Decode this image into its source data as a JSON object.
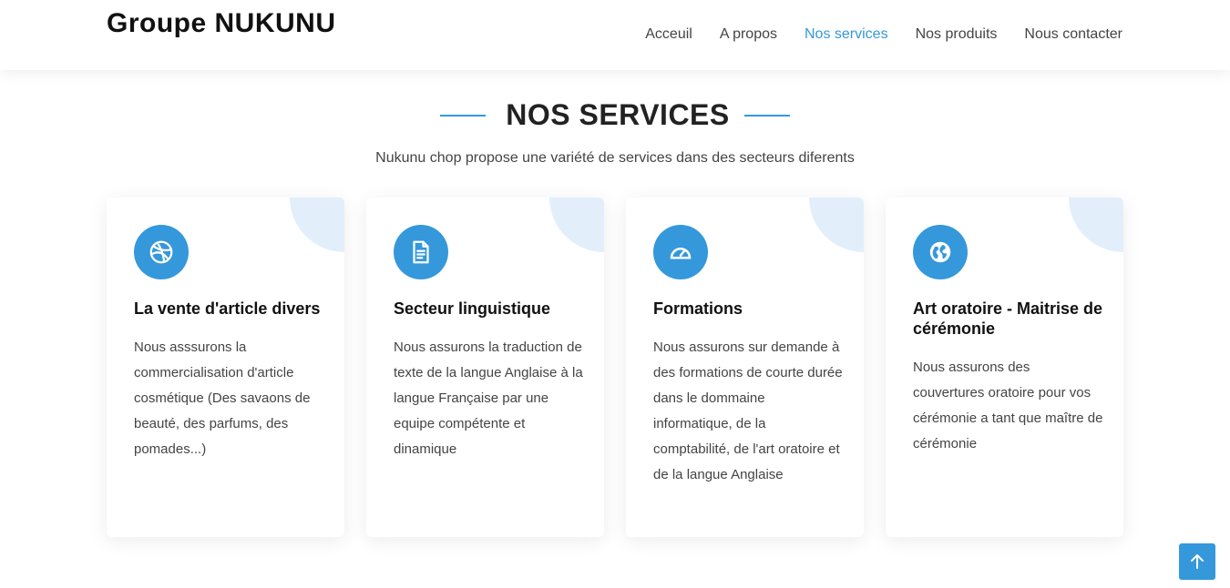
{
  "header": {
    "logo": "Groupe NUKUNU",
    "nav": [
      "Acceuil",
      "A propos",
      "Nos services",
      "Nos produits",
      "Nous contacter"
    ],
    "active_nav": "Nos services"
  },
  "section": {
    "title": "NOS SERVICES",
    "subtitle": "Nukunu chop propose une variété de services dans des secteurs diferents"
  },
  "cards": [
    {
      "icon": "dribbble-icon",
      "title": "La vente d'article divers",
      "text": "Nous asssurons la commercialisation d'article cosmétique (Des savaons de beauté, des parfums, des pomades...)"
    },
    {
      "icon": "file-text-icon",
      "title": "Secteur linguistique",
      "text": "Nous assurons la traduction de texte de la langue Anglaise à la langue Française par une equipe compétente et dinamique"
    },
    {
      "icon": "speedometer-icon",
      "title": "Formations",
      "text": "Nous assurons sur demande à des formations de courte durée dans le dommaine informatique, de la comptabilité, de l'art oratoire et de la langue Anglaise"
    },
    {
      "icon": "globe-icon",
      "title": "Art oratoire - Maitrise de cérémonie",
      "text": "Nous assurons des couvertures oratoire pour vos cérémonie a tant que maître de cérémonie"
    }
  ],
  "back_to_top_icon": "arrow-up-icon",
  "colors": {
    "accent": "#3498db",
    "corner": "#e2effb",
    "heading": "#111111",
    "text": "#444444"
  }
}
